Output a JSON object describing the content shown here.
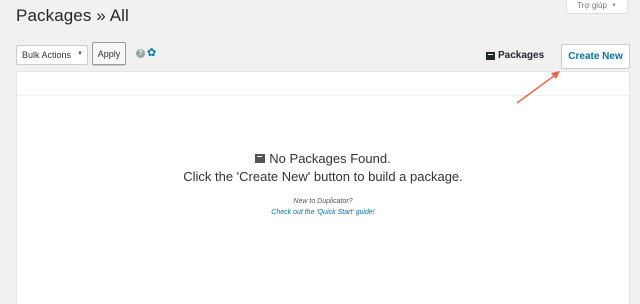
{
  "header": {
    "title": "Packages » All",
    "help_tab": "Trợ giúp"
  },
  "toolbar": {
    "bulk_actions": "Bulk Actions",
    "apply_label": "Apply",
    "help_icon_glyph": "?",
    "packages_label": "Packages",
    "create_new_label": "Create New"
  },
  "empty_state": {
    "title": "No Packages Found.",
    "message": "Click the 'Create New' button to build a package.",
    "new_to": "New to Duplicator?",
    "quick_start": "Check out the 'Quick Start' guide!"
  },
  "colors": {
    "link": "#0073aa",
    "annotation_arrow": "#e8664a"
  }
}
